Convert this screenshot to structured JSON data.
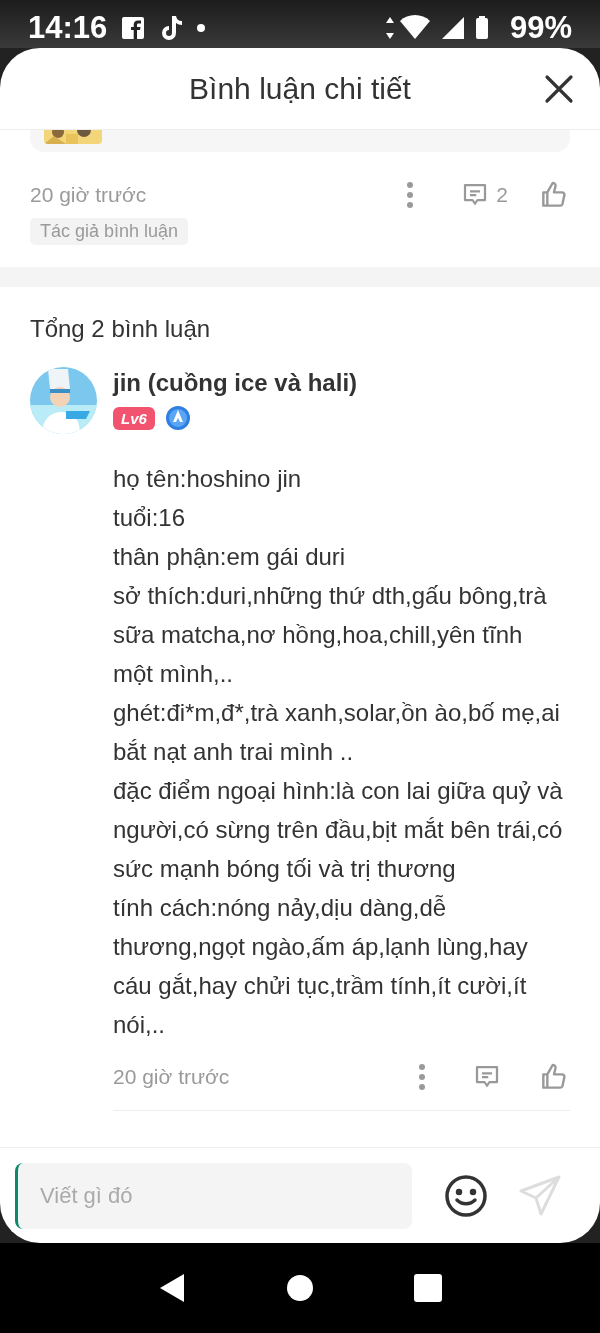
{
  "status_bar": {
    "time": "14:16",
    "battery": "99%"
  },
  "sheet": {
    "title": "Bình luận chi tiết"
  },
  "parent_comment": {
    "time": "20 giờ trước",
    "reply_count": "2",
    "tag": "Tác giả bình luận"
  },
  "total": "Tổng 2 bình luận",
  "comments": [
    {
      "author": "jin (cuồng ice và hali)",
      "level": "Lv6",
      "time": "20 giờ trước",
      "body_lines": [
        "họ tên:hoshino jin",
        "tuổi:16",
        "thân phận:em gái duri",
        "sở thích:duri,những thứ dth,gấu bông,trà sữa matcha,nơ hồng,hoa,chill,yên tĩnh một mình,..",
        "ghét:đi*m,đ*,trà xanh,solar,ồn ào,bố mẹ,ai bắt nạt anh trai mình ..",
        "đặc điểm ngoại hình:là con lai giữa quỷ và người,có sừng trên đầu,bịt mắt bên trái,có sức mạnh bóng tối và trị thương",
        "tính cách:nóng nảy,dịu dàng,dễ thương,ngọt ngào,ấm áp,lạnh lùng,hay cáu gắt,hay chửi tục,trầm tính,ít cười,ít nói,.."
      ]
    }
  ],
  "composer": {
    "placeholder": "Viết gì đó"
  }
}
